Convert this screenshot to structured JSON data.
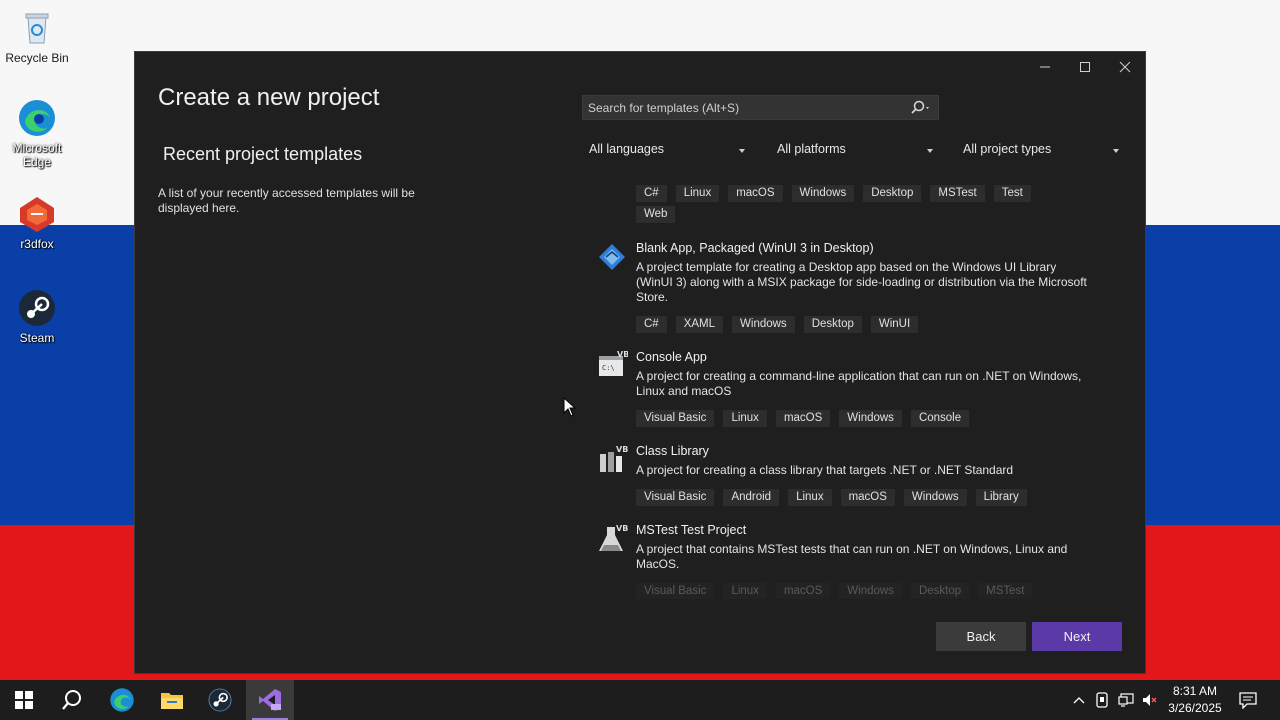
{
  "desktop": {
    "icons": [
      {
        "label": "Recycle Bin",
        "icon": "recycle-bin-icon"
      },
      {
        "label": "Microsoft Edge",
        "icon": "edge-icon"
      },
      {
        "label": "r3dfox",
        "icon": "r3dfox-icon"
      },
      {
        "label": "Steam",
        "icon": "steam-icon"
      }
    ],
    "flag_colors": {
      "white": "#f7f7f7",
      "blue": "#0b3fa8",
      "red": "#e3161a"
    }
  },
  "dialog": {
    "title": "Create a new project",
    "recent_title": "Recent project templates",
    "recent_desc": "A list of your recently accessed templates will be displayed here.",
    "search_placeholder": "Search for templates (Alt+S)",
    "filters": {
      "language": "All languages",
      "platform": "All platforms",
      "project_type": "All project types"
    },
    "top_tags": [
      "C#",
      "Linux",
      "macOS",
      "Windows",
      "Desktop",
      "MSTest",
      "Test",
      "Web"
    ],
    "templates": [
      {
        "name": "Blank App, Packaged (WinUI 3 in Desktop)",
        "icon": "winui-icon",
        "desc": "A project template for creating a Desktop app based on the Windows UI Library (WinUI 3) along with a MSIX package for side-loading or distribution via the Microsoft Store.",
        "tags": [
          "C#",
          "XAML",
          "Windows",
          "Desktop",
          "WinUI"
        ]
      },
      {
        "name": "Console App",
        "icon": "console-vb-icon",
        "desc": "A project for creating a command-line application that can run on .NET on Windows, Linux and macOS",
        "tags": [
          "Visual Basic",
          "Linux",
          "macOS",
          "Windows",
          "Console"
        ]
      },
      {
        "name": "Class Library",
        "icon": "class-library-vb-icon",
        "desc": "A project for creating a class library that targets .NET or .NET Standard",
        "tags": [
          "Visual Basic",
          "Android",
          "Linux",
          "macOS",
          "Windows",
          "Library"
        ]
      },
      {
        "name": "MSTest Test Project",
        "icon": "mstest-vb-icon",
        "desc": "A project that contains MSTest tests that can run on .NET on Windows, Linux and MacOS.",
        "tags": [
          "Visual Basic",
          "Linux",
          "macOS",
          "Windows",
          "Desktop",
          "MSTest"
        ]
      }
    ],
    "buttons": {
      "back": "Back",
      "next": "Next"
    },
    "accent": "#5b3aa8"
  },
  "taskbar": {
    "apps": [
      "windows-start-icon",
      "search-icon",
      "edge-icon",
      "file-explorer-icon",
      "steam-icon",
      "visual-studio-icon"
    ],
    "time": "8:31 AM",
    "date": "3/26/2025"
  }
}
